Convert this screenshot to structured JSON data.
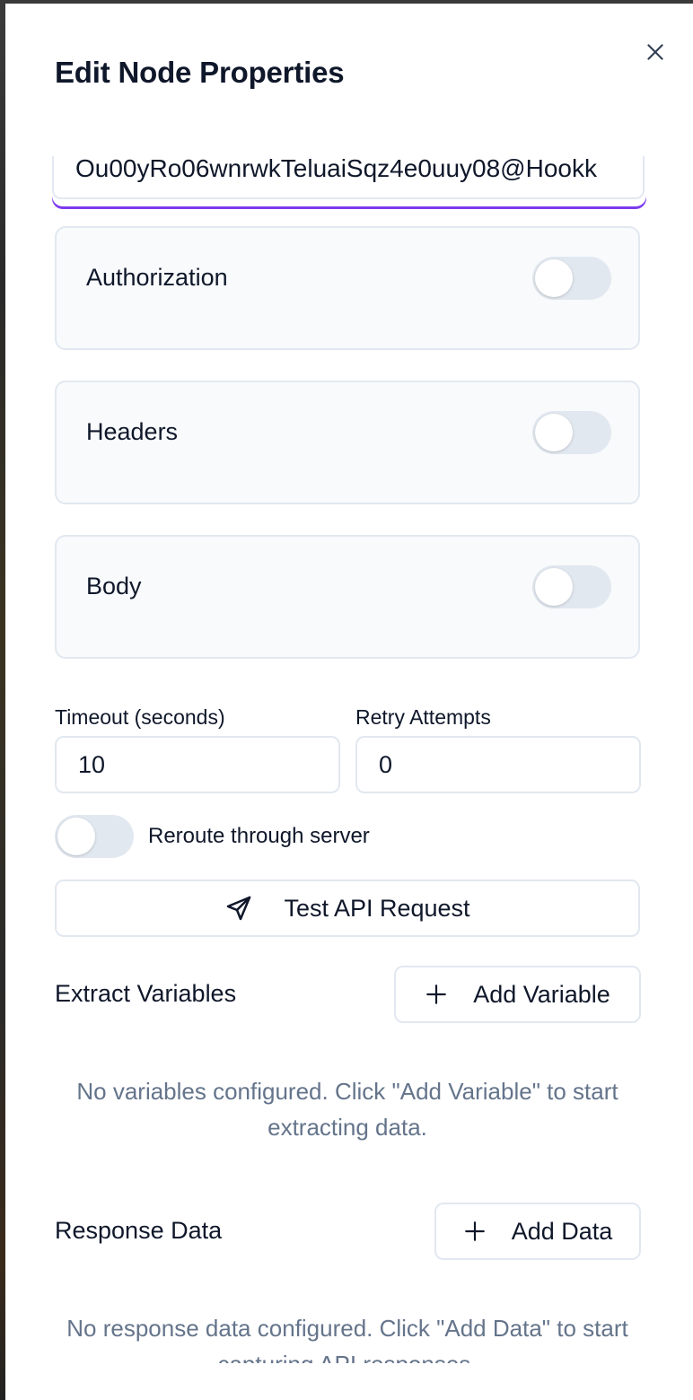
{
  "panel": {
    "title": "Edit Node Properties",
    "close_icon": "close-icon"
  },
  "url_field": {
    "value": "Ou00yRo06wnrwkTeluaiSqz4e0uuy08@Hookk"
  },
  "toggles": [
    {
      "label": "Authorization",
      "enabled": false
    },
    {
      "label": "Headers",
      "enabled": false
    },
    {
      "label": "Body",
      "enabled": false
    }
  ],
  "timeout": {
    "label": "Timeout (seconds)",
    "value": "10"
  },
  "retry": {
    "label": "Retry Attempts",
    "value": "0"
  },
  "reroute": {
    "label": "Reroute through server",
    "enabled": false
  },
  "test_button": {
    "label": "Test API Request",
    "icon": "send-icon"
  },
  "extract_variables": {
    "title": "Extract Variables",
    "add_label": "Add Variable",
    "add_icon": "plus-icon",
    "empty_text": "No variables configured. Click \"Add Variable\" to start extracting data."
  },
  "response_data": {
    "title": "Response Data",
    "add_label": "Add Data",
    "add_icon": "plus-icon",
    "empty_text": "No response data configured. Click \"Add Data\" to start capturing API responses."
  },
  "colors": {
    "accent": "#7c3aed",
    "border": "#e2e8f0",
    "card_bg": "#f8fafc",
    "muted_text": "#64748b",
    "text": "#0f172a"
  }
}
